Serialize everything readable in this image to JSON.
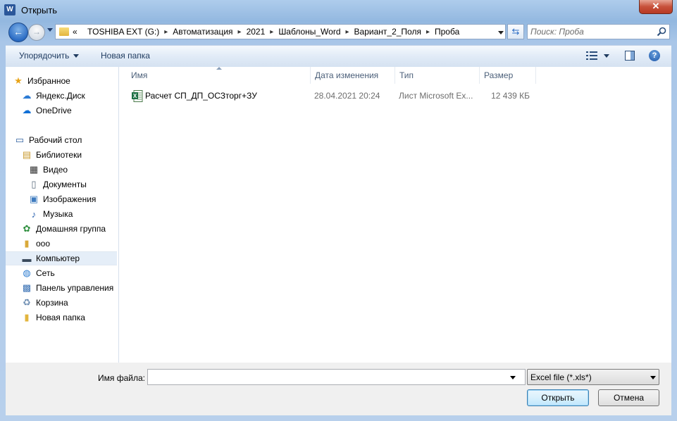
{
  "window": {
    "title": "Открыть",
    "app_icon": "word-icon",
    "close_glyph": "✕"
  },
  "nav": {
    "back_glyph": "←",
    "forward_glyph": "→",
    "address_prefix": "«",
    "breadcrumb": [
      "TOSHIBA EXT (G:)",
      "Автоматизация",
      "2021",
      "Шаблоны_Word",
      "Вариант_2_Поля",
      "Проба"
    ],
    "crumb_separator": "▸",
    "refresh_glyph": "⇆",
    "search_placeholder": "Поиск: Проба"
  },
  "toolbar": {
    "organize_label": "Упорядочить",
    "new_folder_label": "Новая папка",
    "help_glyph": "?"
  },
  "sidebar": {
    "items": [
      {
        "label": "Избранное",
        "icon": "star-icon",
        "glyph": "★",
        "color": "#e8a317"
      },
      {
        "label": "Яндекс.Диск",
        "icon": "yandex-disk-icon",
        "glyph": "☁",
        "color": "#2b7bd4"
      },
      {
        "label": "OneDrive",
        "icon": "onedrive-icon",
        "glyph": "☁",
        "color": "#0f6fd6"
      },
      {
        "label": "Рабочий стол",
        "icon": "desktop-icon",
        "glyph": "▭",
        "color": "#2e5f9e"
      },
      {
        "label": "Библиотеки",
        "icon": "libraries-icon",
        "glyph": "▤",
        "color": "#c99a2e"
      },
      {
        "label": "Видео",
        "icon": "video-icon",
        "glyph": "▦",
        "color": "#333333"
      },
      {
        "label": "Документы",
        "icon": "documents-icon",
        "glyph": "▯",
        "color": "#5a6b7d"
      },
      {
        "label": "Изображения",
        "icon": "pictures-icon",
        "glyph": "▣",
        "color": "#3e7bbf"
      },
      {
        "label": "Музыка",
        "icon": "music-icon",
        "glyph": "♪",
        "color": "#2a62b0"
      },
      {
        "label": "Домашняя группа",
        "icon": "homegroup-icon",
        "glyph": "✿",
        "color": "#2f8f3f"
      },
      {
        "label": "ооо",
        "icon": "user-folder-icon",
        "glyph": "▮",
        "color": "#d9a93a"
      },
      {
        "label": "Компьютер",
        "icon": "computer-icon",
        "glyph": "▬",
        "color": "#3a4a5c"
      },
      {
        "label": "Сеть",
        "icon": "network-icon",
        "glyph": "◍",
        "color": "#2a7bd0"
      },
      {
        "label": "Панель управления",
        "icon": "control-panel-icon",
        "glyph": "▩",
        "color": "#3c73b5"
      },
      {
        "label": "Корзина",
        "icon": "recycle-bin-icon",
        "glyph": "♻",
        "color": "#6a8bb0"
      },
      {
        "label": "Новая папка",
        "icon": "folder-icon",
        "glyph": "▮",
        "color": "#e3b53d"
      }
    ],
    "selected": "Компьютер"
  },
  "files": {
    "columns": [
      "Имя",
      "Дата изменения",
      "Тип",
      "Размер"
    ],
    "rows": [
      {
        "name": "Расчет СП_ДП_ОСЗторг+ЗУ",
        "date": "28.04.2021 20:24",
        "type": "Лист Microsoft Ex...",
        "size": "12 439 КБ",
        "icon": "excel-file-icon"
      }
    ]
  },
  "footer": {
    "filename_label": "Имя файла:",
    "filename_value": "",
    "filetype_selected": "Excel file (*.xls*)",
    "open_label": "Открыть",
    "cancel_label": "Отмена"
  }
}
